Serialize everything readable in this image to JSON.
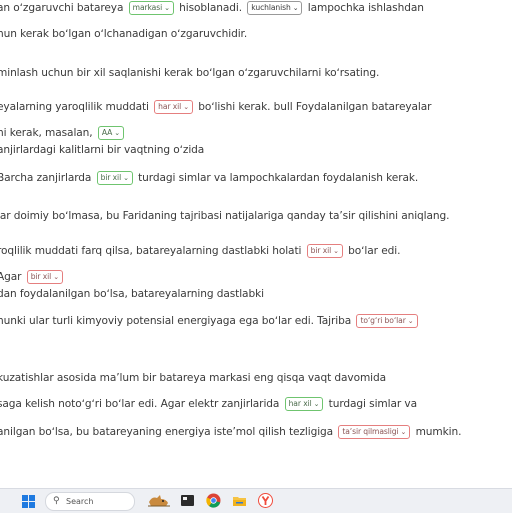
{
  "lines": [
    {
      "parts": [
        {
          "t": "an oʻzgaruvchi batareya"
        },
        {
          "sel": "markasi",
          "s": "ok"
        },
        {
          "t": "hisoblanadi."
        },
        {
          "sel": "kuchlanish",
          "s": "plain"
        },
        {
          "t": "lampochka ishlashdan"
        }
      ]
    },
    {
      "parts": [
        {
          "t": "hun kerak boʻlgan oʻlchanadigan oʻzgaruvchidir."
        }
      ]
    },
    {
      "parts": [
        {
          "t": "minlash uchun bir xil saqlanishi kerak boʻlgan oʻzgaruvchilarni koʻrsating."
        }
      ]
    },
    {
      "parts": [
        {
          "t": "eyalarning yaroqlilik muddati"
        },
        {
          "sel": "har xil",
          "s": "bad"
        },
        {
          "t": "boʻlishi kerak. bull Foydalanilgan batareyalar"
        }
      ]
    },
    {
      "parts": [
        {
          "t": "hi kerak, masalan,"
        },
        {
          "sel": "AA",
          "s": "ok"
        }
      ]
    },
    {
      "parts": [
        {
          "t": "anjirlardagi kalitlarni bir vaqtning oʻzida"
        }
      ]
    },
    {
      "parts": [
        {
          "t": "Barcha zanjirlarda"
        },
        {
          "sel": "bir xil",
          "s": "ok"
        },
        {
          "t": "turdagi simlar va lampochkalardan foydalanish kerak."
        }
      ]
    },
    {
      "parts": [
        {
          "t": "lar doimiy boʻlmasa, bu Faridaning tajribasi natijalariga qanday taʼsir qilishini aniqlang."
        }
      ]
    },
    {
      "parts": [
        {
          "t": "roqlilik muddati farq qilsa, batareyalarning dastlabki holati"
        },
        {
          "sel": "bir xil",
          "s": "bad"
        },
        {
          "t": "boʻlar edi."
        }
      ]
    },
    {
      "parts": [
        {
          "t": "Agar"
        },
        {
          "sel": "bir xil",
          "s": "bad"
        }
      ]
    },
    {
      "parts": [
        {
          "t": "dan foydalanilgan boʻlsa, batareyalarning dastlabki"
        }
      ]
    },
    {
      "parts": [
        {
          "t": "hunki ular turli kimyoviy potensial energiyaga ega boʻlar edi. Tajriba"
        },
        {
          "sel": "toʻgʻri boʻlar",
          "s": "bad"
        }
      ]
    },
    {
      "parts": [
        {
          "t": "kuzatishlar asosida maʼlum bir batareya markasi eng qisqa vaqt davomida"
        }
      ]
    },
    {
      "parts": [
        {
          "t": "saga kelish notoʻgʻri boʻlar edi. Agar elektr zanjirlarida"
        },
        {
          "sel": "har xil",
          "s": "ok"
        },
        {
          "t": "turdagi simlar va"
        }
      ]
    },
    {
      "parts": [
        {
          "t": "anilgan boʻlsa, bu batareyaning energiya isteʼmol qilish tezligiga"
        },
        {
          "sel": "taʼsir qilmasligi",
          "s": "bad"
        },
        {
          "t": "mumkin."
        }
      ]
    }
  ],
  "taskbar": {
    "search_label": "Search",
    "icons": [
      "windows-start-icon",
      "search-icon",
      "animal-widget-icon",
      "terminal-icon",
      "chrome-icon",
      "file-explorer-icon",
      "yandex-browser-icon"
    ]
  },
  "colors": {
    "correct_border": "#6fc46f",
    "incorrect_border": "#e57f7f",
    "taskbar_bg": "#eef0f4",
    "windows_blue": "#1f7ae0"
  }
}
